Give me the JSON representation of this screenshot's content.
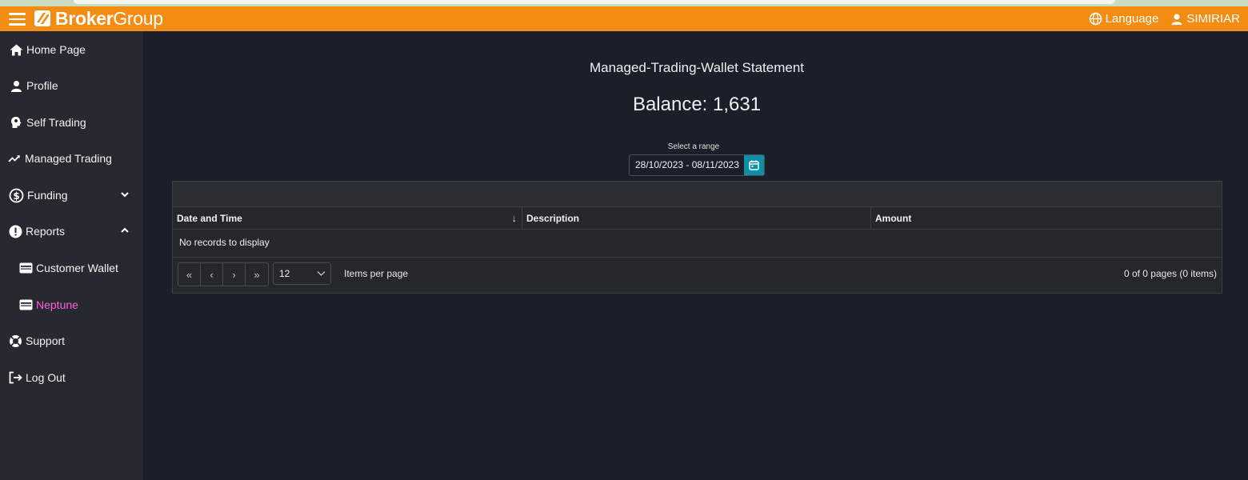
{
  "header": {
    "brand_bold": "Broker",
    "brand_light": "Group",
    "language_label": "Language",
    "user_label": "SIMIRIAR",
    "accent_color": "#f28c13"
  },
  "sidebar": {
    "items": [
      {
        "label": "Home Page",
        "icon": "home-icon"
      },
      {
        "label": "Profile",
        "icon": "person-icon"
      },
      {
        "label": "Self Trading",
        "icon": "head-icon"
      },
      {
        "label": "Managed Trading",
        "icon": "trend-icon"
      },
      {
        "label": "Funding",
        "icon": "funding-icon",
        "chevron": "down"
      },
      {
        "label": "Reports",
        "icon": "alert-icon",
        "chevron": "up"
      },
      {
        "label": "Customer Wallet",
        "icon": "wallet-icon"
      },
      {
        "label": "Neptune",
        "icon": "wallet-icon",
        "active": true
      },
      {
        "label": "Support",
        "icon": "lifebuoy-icon"
      },
      {
        "label": "Log Out",
        "icon": "logout-icon"
      }
    ],
    "active_color": "#ff5de0"
  },
  "main": {
    "title": "Managed-Trading-Wallet Statement",
    "balance": "Balance: 1,631",
    "range_label": "Select a range",
    "range_value": "28/10/2023 - 08/11/2023"
  },
  "grid": {
    "columns": [
      "Date and Time",
      "Description",
      "Amount"
    ],
    "sort_indicator": "↓",
    "empty_text": "No records to display",
    "page_size": "12",
    "items_per_page_label": "Items per page",
    "page_info": "0 of 0 pages (0 items)"
  }
}
